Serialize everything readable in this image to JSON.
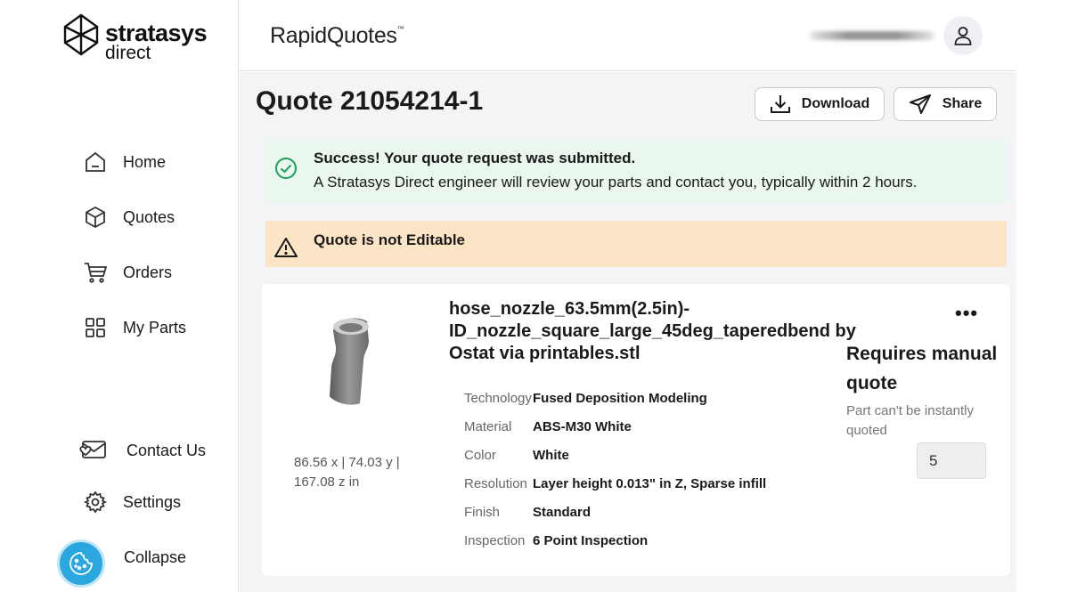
{
  "brand": {
    "logo_line1": "stratasys",
    "logo_line2": "direct",
    "app_name": "RapidQuotes",
    "app_mark": "™"
  },
  "sidebar": {
    "items": [
      {
        "label": "Home",
        "icon": "home-icon"
      },
      {
        "label": "Quotes",
        "icon": "cube-icon"
      },
      {
        "label": "Orders",
        "icon": "cart-icon"
      },
      {
        "label": "My Parts",
        "icon": "grid-icon"
      },
      {
        "label": "Contact Us",
        "icon": "envelope-heart-icon"
      },
      {
        "label": "Settings",
        "icon": "gear-icon"
      },
      {
        "label": "Collapse",
        "icon": "collapse-icon"
      }
    ],
    "cookie_button_icon": "cookie-icon"
  },
  "header": {
    "avatar_icon": "user-icon"
  },
  "quote": {
    "title": "Quote 21054214-1",
    "download_label": "Download",
    "share_label": "Share"
  },
  "alerts": {
    "success_title": "Success! Your quote request was submitted.",
    "success_body": "A Stratasys Direct engineer will review your parts and contact you, typically within 2 hours.",
    "warning_title": "Quote is not Editable"
  },
  "part": {
    "name": "hose_nozzle_63.5mm(2.5in)-ID_nozzle_square_large_45deg_taperedbend by Ostat via printables.stl",
    "dimensions": "86.56 x | 74.03 y | 167.08 z in",
    "more_label": "•••",
    "specs": [
      {
        "key": "Technology",
        "value": "Fused Deposition Modeling"
      },
      {
        "key": "Material",
        "value": "ABS-M30 White"
      },
      {
        "key": "Color",
        "value": "White"
      },
      {
        "key": "Resolution",
        "value": "Layer height 0.013\" in Z, Sparse infill"
      },
      {
        "key": "Finish",
        "value": "Standard"
      },
      {
        "key": "Inspection",
        "value": "6 Point Inspection"
      }
    ],
    "manual_quote_title": "Requires manual quote",
    "manual_quote_sub": "Part can't be instantly quoted",
    "quantity": "5"
  },
  "colors": {
    "success_bg": "#e9f7ee",
    "success_icon": "#1e9e55",
    "warning_bg": "#fce4c7",
    "cookie_button": "#2aa7de"
  }
}
